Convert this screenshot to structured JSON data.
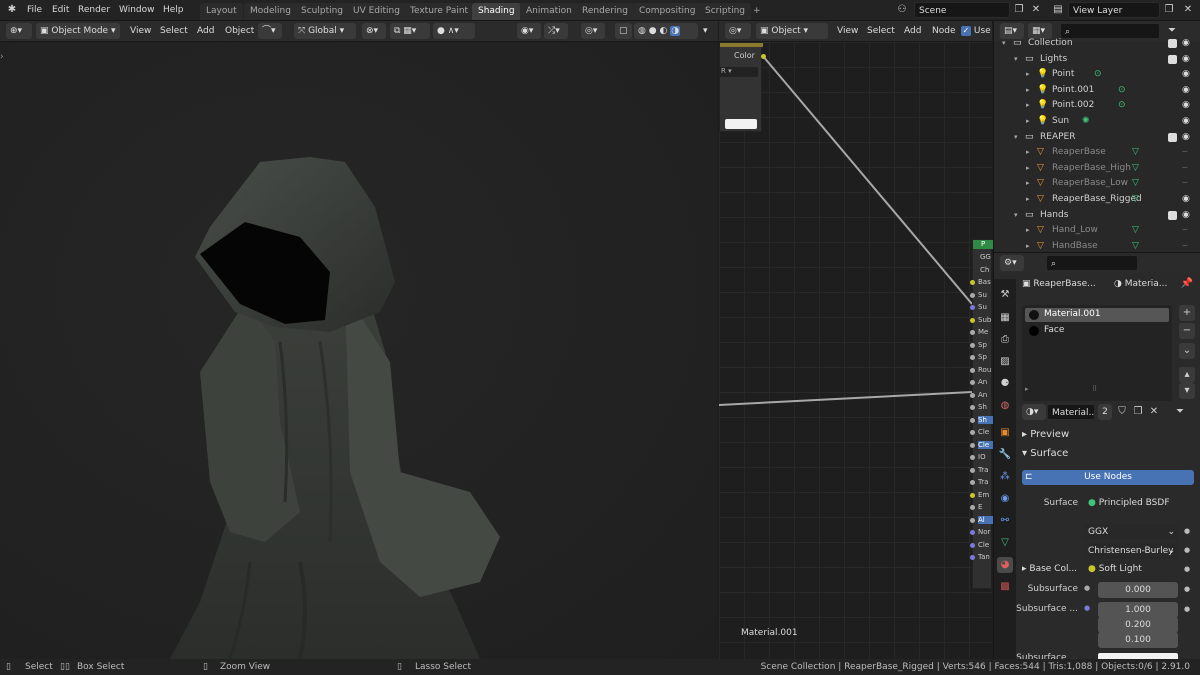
{
  "topbar": {
    "menus": [
      "File",
      "Edit",
      "Render",
      "Window",
      "Help"
    ],
    "workspaces": [
      "Layout",
      "Modeling",
      "Sculpting",
      "UV Editing",
      "Texture Paint",
      "Shading",
      "Animation",
      "Rendering",
      "Compositing",
      "Scripting"
    ],
    "active_workspace": "Shading",
    "add_tab": "+",
    "scene": "Scene",
    "view_layer": "View Layer"
  },
  "viewport_header": {
    "mode": "Object Mode",
    "menus": [
      "View",
      "Select",
      "Add",
      "Object"
    ],
    "orientation": "Global"
  },
  "node_header": {
    "object_type": "Object",
    "menus": [
      "View",
      "Select",
      "Add",
      "Node"
    ],
    "use_nodes_label": "Use N"
  },
  "node_editor": {
    "texture_node": {
      "output": "Color",
      "dropdown": "R"
    },
    "bsdf_header": "P",
    "bsdf_inputs": [
      "GG",
      "Ch",
      "Bas",
      "Su",
      "Su",
      "Sub",
      "Me",
      "Sp",
      "Sp",
      "Rou",
      "An",
      "An",
      "Sh",
      "Sh",
      "Cle",
      "Cle",
      "IO",
      "Tra",
      "Tra",
      "Em",
      "E",
      "Al",
      "Nor",
      "Cle",
      "Tan"
    ],
    "material_label": "Material.001"
  },
  "outliner": {
    "rows": [
      {
        "label": "Collection",
        "indent": 0,
        "kind": "collection"
      },
      {
        "label": "Lights",
        "indent": 1,
        "kind": "collection"
      },
      {
        "label": "Point",
        "indent": 2,
        "kind": "light"
      },
      {
        "label": "Point.001",
        "indent": 2,
        "kind": "light"
      },
      {
        "label": "Point.002",
        "indent": 2,
        "kind": "light"
      },
      {
        "label": "Sun",
        "indent": 2,
        "kind": "sun"
      },
      {
        "label": "REAPER",
        "indent": 1,
        "kind": "collection"
      },
      {
        "label": "ReaperBase",
        "indent": 2,
        "kind": "mesh",
        "dim": true
      },
      {
        "label": "ReaperBase_High",
        "indent": 2,
        "kind": "mesh",
        "dim": true
      },
      {
        "label": "ReaperBase_Low",
        "indent": 2,
        "kind": "mesh",
        "dim": true
      },
      {
        "label": "ReaperBase_Rigged",
        "indent": 2,
        "kind": "mesh",
        "dim": false
      },
      {
        "label": "Hands",
        "indent": 1,
        "kind": "collection"
      },
      {
        "label": "Hand_Low",
        "indent": 2,
        "kind": "mesh",
        "dim": true
      },
      {
        "label": "HandBase",
        "indent": 2,
        "kind": "mesh",
        "dim": true
      }
    ]
  },
  "properties": {
    "object_name": "ReaperBase...",
    "material_short": "Materia...",
    "slots": [
      "Material.001",
      "Face"
    ],
    "material_field": "Material...",
    "user_count": "2",
    "preview_label": "Preview",
    "surface_panel": "Surface",
    "use_nodes": "Use Nodes",
    "surface_label": "Surface",
    "surface_value": "Principled BSDF",
    "distribution": "GGX",
    "subsurface_method": "Christensen-Burley",
    "base_color_label": "Base Col...",
    "base_color_value": "Soft Light",
    "subsurface_label": "Subsurface",
    "subsurface_value": "0.000",
    "subsurface_radius_label": "Subsurface ...",
    "radius": [
      "1.000",
      "0.200",
      "0.100"
    ],
    "subsurface_color_label": "Subsurface ..."
  },
  "status": {
    "select": "Select",
    "box_select": "Box Select",
    "zoom_view": "Zoom View",
    "lasso_select": "Lasso Select",
    "stats": "Scene Collection | ReaperBase_Rigged | Verts:546 | Faces:544 | Tris:1,088 | Objects:0/6 | 2.91.0"
  },
  "colors": {
    "accent": "#4772b3",
    "selected": "#334d80",
    "outliner_bg": "#282828"
  }
}
